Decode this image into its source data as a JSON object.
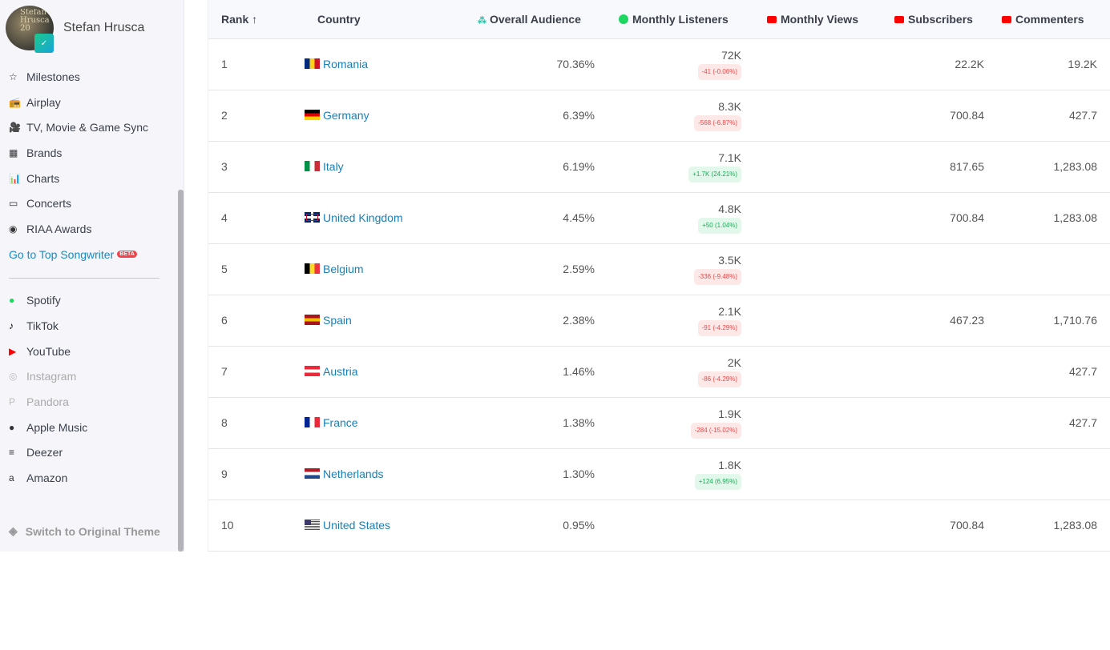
{
  "profile": {
    "name": "Stefan Hrusca",
    "avatar_text": "Stefan Hrusca 20"
  },
  "nav": [
    {
      "label": "Milestones",
      "icon": "star-icon",
      "glyph": "☆"
    },
    {
      "label": "Airplay",
      "icon": "radio-icon",
      "glyph": "📻"
    },
    {
      "label": "TV, Movie & Game Sync",
      "icon": "video-camera-icon",
      "glyph": "🎥"
    },
    {
      "label": "Brands",
      "icon": "building-icon",
      "glyph": "▦"
    },
    {
      "label": "Charts",
      "icon": "chart-icon",
      "glyph": "📊"
    },
    {
      "label": "Concerts",
      "icon": "ticket-icon",
      "glyph": "▭"
    },
    {
      "label": "RIAA Awards",
      "icon": "riaa-icon",
      "glyph": "◉"
    }
  ],
  "songwriter_link": "Go to Top Songwriter",
  "beta": "BETA",
  "platforms": [
    {
      "label": "Spotify",
      "icon": "spotify-icon",
      "glyph": "●",
      "color": "#1ed760"
    },
    {
      "label": "TikTok",
      "icon": "tiktok-icon",
      "glyph": "♪",
      "color": "#000"
    },
    {
      "label": "YouTube",
      "icon": "youtube-icon",
      "glyph": "▶",
      "color": "#f00"
    },
    {
      "label": "Instagram",
      "icon": "instagram-icon",
      "glyph": "◎",
      "color": "#bbb"
    },
    {
      "label": "Pandora",
      "icon": "pandora-icon",
      "glyph": "P",
      "color": "#bbb"
    },
    {
      "label": "Apple Music",
      "icon": "apple-icon",
      "glyph": "●",
      "color": "#333"
    },
    {
      "label": "Deezer",
      "icon": "deezer-icon",
      "glyph": "≡",
      "color": "#333"
    },
    {
      "label": "Amazon",
      "icon": "amazon-icon",
      "glyph": "a",
      "color": "#333"
    }
  ],
  "switch_theme": "Switch to Original Theme",
  "table": {
    "headers": {
      "rank": "Rank",
      "rank_sort": "↑",
      "country": "Country",
      "overall": "Overall Audience",
      "listeners": "Monthly Listeners",
      "views": "Monthly Views",
      "subscribers": "Subscribers",
      "commenters": "Commenters"
    },
    "rows": [
      {
        "rank": "1",
        "country": "Romania",
        "flag": [
          "#002b7f",
          "#fcd116",
          "#ce1126"
        ],
        "overall": "70.36%",
        "listeners": "72K",
        "change": "-41 (-0.06%)",
        "trend": "neg",
        "views": "",
        "subscribers": "22.2K",
        "commenters": "19.2K"
      },
      {
        "rank": "2",
        "country": "Germany",
        "flag": [
          "#000",
          "#dd0000",
          "#ffce00"
        ],
        "fh": 1,
        "overall": "6.39%",
        "listeners": "8.3K",
        "change": "-568 (-6.87%)",
        "trend": "neg",
        "views": "",
        "subscribers": "700.84",
        "commenters": "427.7"
      },
      {
        "rank": "3",
        "country": "Italy",
        "flag": [
          "#009246",
          "#fff",
          "#ce2b37"
        ],
        "overall": "6.19%",
        "listeners": "7.1K",
        "change": "+1.7K (24.21%)",
        "trend": "pos",
        "views": "",
        "subscribers": "817.65",
        "commenters": "1,283.08"
      },
      {
        "rank": "4",
        "country": "United Kingdom",
        "flag": [
          "#012169",
          "#c8102e",
          "#fff"
        ],
        "uk": 1,
        "overall": "4.45%",
        "listeners": "4.8K",
        "change": "+50 (1.04%)",
        "trend": "pos",
        "views": "",
        "subscribers": "700.84",
        "commenters": "1,283.08"
      },
      {
        "rank": "5",
        "country": "Belgium",
        "flag": [
          "#000",
          "#fdda24",
          "#ef3340"
        ],
        "overall": "2.59%",
        "listeners": "3.5K",
        "change": "-336 (-9.48%)",
        "trend": "neg",
        "views": "",
        "subscribers": "",
        "commenters": ""
      },
      {
        "rank": "6",
        "country": "Spain",
        "flag": [
          "#aa151b",
          "#f1bf00",
          "#aa151b"
        ],
        "fh": 1,
        "overall": "2.38%",
        "listeners": "2.1K",
        "change": "-91 (-4.29%)",
        "trend": "neg",
        "views": "",
        "subscribers": "467.23",
        "commenters": "1,710.76"
      },
      {
        "rank": "7",
        "country": "Austria",
        "flag": [
          "#ed2939",
          "#fff",
          "#ed2939"
        ],
        "fh": 1,
        "overall": "1.46%",
        "listeners": "2K",
        "change": "-86 (-4.29%)",
        "trend": "neg",
        "views": "",
        "subscribers": "",
        "commenters": "427.7"
      },
      {
        "rank": "8",
        "country": "France",
        "flag": [
          "#002395",
          "#fff",
          "#ed2939"
        ],
        "overall": "1.38%",
        "listeners": "1.9K",
        "change": "-284 (-15.02%)",
        "trend": "neg",
        "views": "",
        "subscribers": "",
        "commenters": "427.7"
      },
      {
        "rank": "9",
        "country": "Netherlands",
        "flag": [
          "#ae1c28",
          "#fff",
          "#21468b"
        ],
        "fh": 1,
        "overall": "1.30%",
        "listeners": "1.8K",
        "change": "+124 (6.95%)",
        "trend": "pos",
        "views": "",
        "subscribers": "",
        "commenters": ""
      },
      {
        "rank": "10",
        "country": "United States",
        "flag": [
          "#b22234",
          "#fff",
          "#3c3b6e"
        ],
        "us": 1,
        "overall": "0.95%",
        "listeners": "",
        "change": "",
        "trend": "",
        "views": "",
        "subscribers": "700.84",
        "commenters": "1,283.08"
      }
    ]
  }
}
